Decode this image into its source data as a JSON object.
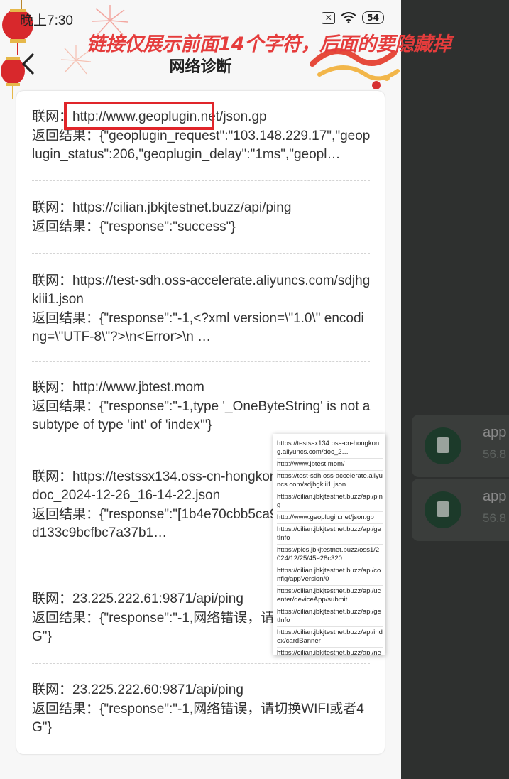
{
  "status_bar": {
    "time": "晚上7:30",
    "battery": "54"
  },
  "nav": {
    "title": "网络诊断"
  },
  "annotation": {
    "text": "链接仅展示前面14个字符，后面的要隐藏掉"
  },
  "entries": [
    {
      "net_label": "联网：",
      "url": "http://www.geoplugin.net/json.gp",
      "result_label": "返回结果：",
      "result": "{\"geoplugin_request\":\"103.148.229.17\",\"geoplugin_status\":206,\"geoplugin_delay\":\"1ms\",\"geopl…"
    },
    {
      "net_label": "联网：",
      "url": "https://cilian.jbkjtestnet.buzz/api/ping",
      "result_label": "返回结果：",
      "result": "{\"response\":\"success\"}"
    },
    {
      "net_label": "联网：",
      "url": "https://test-sdh.oss-accelerate.aliyuncs.com/sdjhgkiii1.json",
      "result_label": "返回结果：",
      "result": "{\"response\":\"-1,<?xml version=\\\"1.0\\\" encoding=\\\"UTF-8\\\"?>\\n<Error>\\n  …"
    },
    {
      "net_label": "联网：",
      "url": "http://www.jbtest.mom",
      "result_label": "返回结果：",
      "result": "{\"response\":\"-1,type '_OneByteString' is not a subtype of type 'int' of 'index'\"}"
    },
    {
      "net_label": "联网：",
      "url": "https://testssx134.oss-cn-hongkong.aliyuncs.com/doc_2024-12-26_16-14-22.json",
      "result_label": "返回结果：",
      "result": "{\"response\":\"[1b4e70cbb5ca958cee4f01f3f7cd133c9bcfbc7a37b1…"
    },
    {
      "net_label": "联网：",
      "url": "23.225.222.61:9871/api/ping",
      "result_label": "返回结果：",
      "result": "{\"response\":\"-1,网络错误，请切换WIFI或者4G\"}"
    },
    {
      "net_label": "联网：",
      "url": "23.225.222.60:9871/api/ping",
      "result_label": "返回结果：",
      "result": "{\"response\":\"-1,网络错误，请切换WIFI或者4G\"}"
    }
  ],
  "popup_items": [
    "https://testssx134.oss-cn-hongkong.aliyuncs.com/doc_2…",
    "http://www.jbtest.mom/",
    "https://test-sdh.oss-accelerate.aliyuncs.com/sdjhgkiii1.json",
    "https://cilian.jbkjtestnet.buzz/api/ping",
    "http://www.geoplugin.net/json.gp",
    "https://cilian.jbkjtestnet.buzz/api/getInfo",
    "https://pics.jbkjtestnet.buzz/oss1/2024/12/25/45e28c320…",
    "https://cilian.jbkjtestnet.buzz/api/config/appVersion/0",
    "https://cilian.jbkjtestnet.buzz/api/ucenter/deviceApp/submit",
    "https://cilian.jbkjtestnet.buzz/api/getInfo",
    "https://cilian.jbkjtestnet.buzz/api/index/cardBanner",
    "https://cilian.jbkjtestnet.buzz/api/news/list"
  ],
  "background_cards": [
    {
      "title": "app",
      "size": "56.8"
    },
    {
      "title": "app",
      "size": "56.8"
    }
  ]
}
